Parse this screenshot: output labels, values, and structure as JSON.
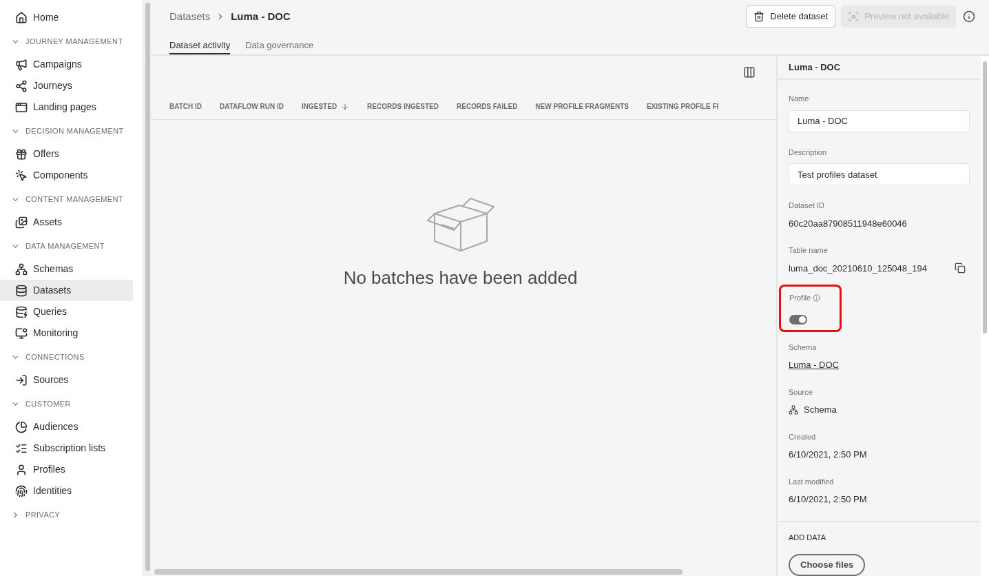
{
  "sidebar": {
    "items": [
      {
        "kind": "item",
        "label": "Home",
        "selected": false
      },
      {
        "kind": "section",
        "label": "JOURNEY MANAGEMENT",
        "expanded": true
      },
      {
        "kind": "item",
        "label": "Campaigns",
        "selected": false
      },
      {
        "kind": "item",
        "label": "Journeys",
        "selected": false
      },
      {
        "kind": "item",
        "label": "Landing pages",
        "selected": false
      },
      {
        "kind": "section",
        "label": "DECISION MANAGEMENT",
        "expanded": true
      },
      {
        "kind": "item",
        "label": "Offers",
        "selected": false
      },
      {
        "kind": "item",
        "label": "Components",
        "selected": false
      },
      {
        "kind": "section",
        "label": "CONTENT MANAGEMENT",
        "expanded": true
      },
      {
        "kind": "item",
        "label": "Assets",
        "selected": false
      },
      {
        "kind": "section",
        "label": "DATA MANAGEMENT",
        "expanded": true
      },
      {
        "kind": "item",
        "label": "Schemas",
        "selected": false
      },
      {
        "kind": "item",
        "label": "Datasets",
        "selected": true
      },
      {
        "kind": "item",
        "label": "Queries",
        "selected": false
      },
      {
        "kind": "item",
        "label": "Monitoring",
        "selected": false
      },
      {
        "kind": "section",
        "label": "CONNECTIONS",
        "expanded": true
      },
      {
        "kind": "item",
        "label": "Sources",
        "selected": false
      },
      {
        "kind": "section",
        "label": "CUSTOMER",
        "expanded": true
      },
      {
        "kind": "item",
        "label": "Audiences",
        "selected": false
      },
      {
        "kind": "item",
        "label": "Subscription lists",
        "selected": false
      },
      {
        "kind": "item",
        "label": "Profiles",
        "selected": false
      },
      {
        "kind": "item",
        "label": "Identities",
        "selected": false
      },
      {
        "kind": "section",
        "label": "PRIVACY",
        "expanded": false
      }
    ]
  },
  "breadcrumb": {
    "parent": "Datasets",
    "current": "Luma - DOC"
  },
  "actions": [
    {
      "label": "Delete dataset",
      "disabled": false
    },
    {
      "label": "Preview not available",
      "disabled": true
    }
  ],
  "tabs": [
    {
      "label": "Dataset activity",
      "selected": true
    },
    {
      "label": "Data governance",
      "selected": false
    }
  ],
  "table": {
    "columns": [
      {
        "label": "BATCH ID",
        "sorted": false
      },
      {
        "label": "DATAFLOW RUN ID",
        "sorted": false
      },
      {
        "label": "INGESTED",
        "sorted": true
      },
      {
        "label": "RECORDS INGESTED",
        "sorted": false
      },
      {
        "label": "RECORDS FAILED",
        "sorted": false
      },
      {
        "label": "NEW PROFILE FRAGMENTS",
        "sorted": false
      },
      {
        "label": "EXISTING PROFILE FI",
        "sorted": false
      }
    ],
    "empty_message": "No batches have been added"
  },
  "details": {
    "title": "Luma - DOC",
    "name": {
      "label": "Name",
      "value": "Luma - DOC"
    },
    "description": {
      "label": "Description",
      "value": "Test profiles dataset"
    },
    "dataset_id": {
      "label": "Dataset ID",
      "value": "60c20aa87908511948e60046"
    },
    "table_name": {
      "label": "Table name",
      "value": "luma_doc_20210610_125048_194"
    },
    "profile": {
      "label": "Profile",
      "on": true,
      "highlighted": true
    },
    "schema": {
      "label": "Schema",
      "value": "Luma - DOC"
    },
    "source": {
      "label": "Source",
      "value": "Schema"
    },
    "created": {
      "label": "Created",
      "value": "6/10/2021, 2:50 PM"
    },
    "last_modified": {
      "label": "Last modified",
      "value": "6/10/2021, 2:50 PM"
    },
    "add_data": {
      "title": "ADD DATA",
      "button": "Choose files"
    }
  }
}
